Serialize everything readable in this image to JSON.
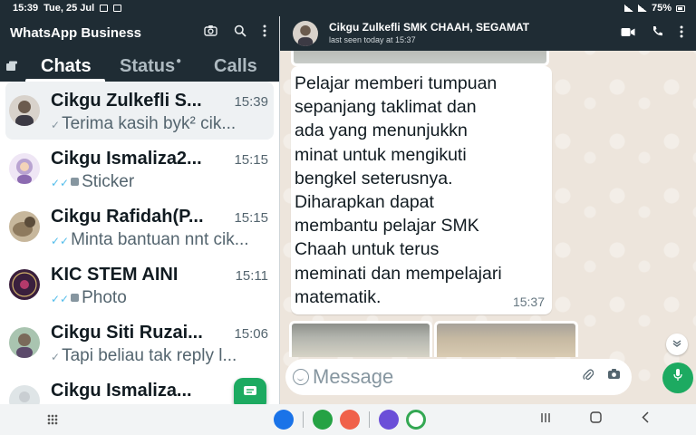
{
  "status_bar": {
    "time": "15:39",
    "date": "Tue, 25 Jul",
    "battery": "75%"
  },
  "app": {
    "title": "WhatsApp Business"
  },
  "header_icons": [
    "camera-icon",
    "search-icon",
    "more-vert-icon"
  ],
  "tabs": [
    {
      "label": "Chats",
      "active": true
    },
    {
      "label": "Status",
      "active": false
    },
    {
      "label": "Calls",
      "active": false
    }
  ],
  "chats": [
    {
      "name": "Cikgu Zulkefli S...",
      "time": "15:39",
      "preview": "Terima kasih byk² cik...",
      "tick": "single",
      "avatar_color": "#6b5b4e"
    },
    {
      "name": "Cikgu Ismaliza2...",
      "time": "15:15",
      "preview": "Sticker",
      "tick": "double-blue",
      "prefix_icon": "sticker-icon",
      "avatar_color": "#b9a3d1"
    },
    {
      "name": "Cikgu Rafidah(P...",
      "time": "15:15",
      "preview": "Minta bantuan nnt cik...",
      "tick": "double-blue",
      "avatar_color": "#8e7a5e"
    },
    {
      "name": "KIC STEM AINI",
      "time": "15:11",
      "preview": "Photo",
      "tick": "double-blue",
      "prefix_icon": "photo-icon",
      "avatar_color": "#3a1f3d"
    },
    {
      "name": "Cikgu Siti Ruzai...",
      "time": "15:06",
      "preview": "Tapi beliau tak reply l...",
      "tick": "single",
      "avatar_color": "#7a6a5a"
    },
    {
      "name": "Cikgu Ismaliza...",
      "time": "",
      "preview": "",
      "tick": "none",
      "avatar_color": "#c9ced2"
    }
  ],
  "conversation": {
    "name": "Cikgu Zulkefli SMK CHAAH, SEGAMAT",
    "last_seen": "last seen today at 15:37",
    "message": "Pelajar memberi tumpuan\nsepanjang taklimat dan\nada yang menunjukkn\nminat untuk mengikuti\nbengkel seterusnya.\nDiharapkan dapat\nmembantu pelajar SMK\nChaah untuk terus\nmeminati dan mempelajari\nmatematik.",
    "message_time": "15:37",
    "input_placeholder": "Message"
  },
  "colors": {
    "header_bg": "#1f2c34",
    "accent_green": "#1daa61",
    "chat_bg": "#ede5dc"
  },
  "dock_apps": [
    {
      "name": "messages-app",
      "color": "#1a73e8"
    },
    {
      "name": "whatsapp-business-app",
      "color": "#25a244"
    },
    {
      "name": "contacts-app",
      "color": "#f0614a"
    },
    {
      "name": "internet-app",
      "color": "#6b4fd8"
    },
    {
      "name": "maps-app",
      "color": "#34a853"
    }
  ]
}
